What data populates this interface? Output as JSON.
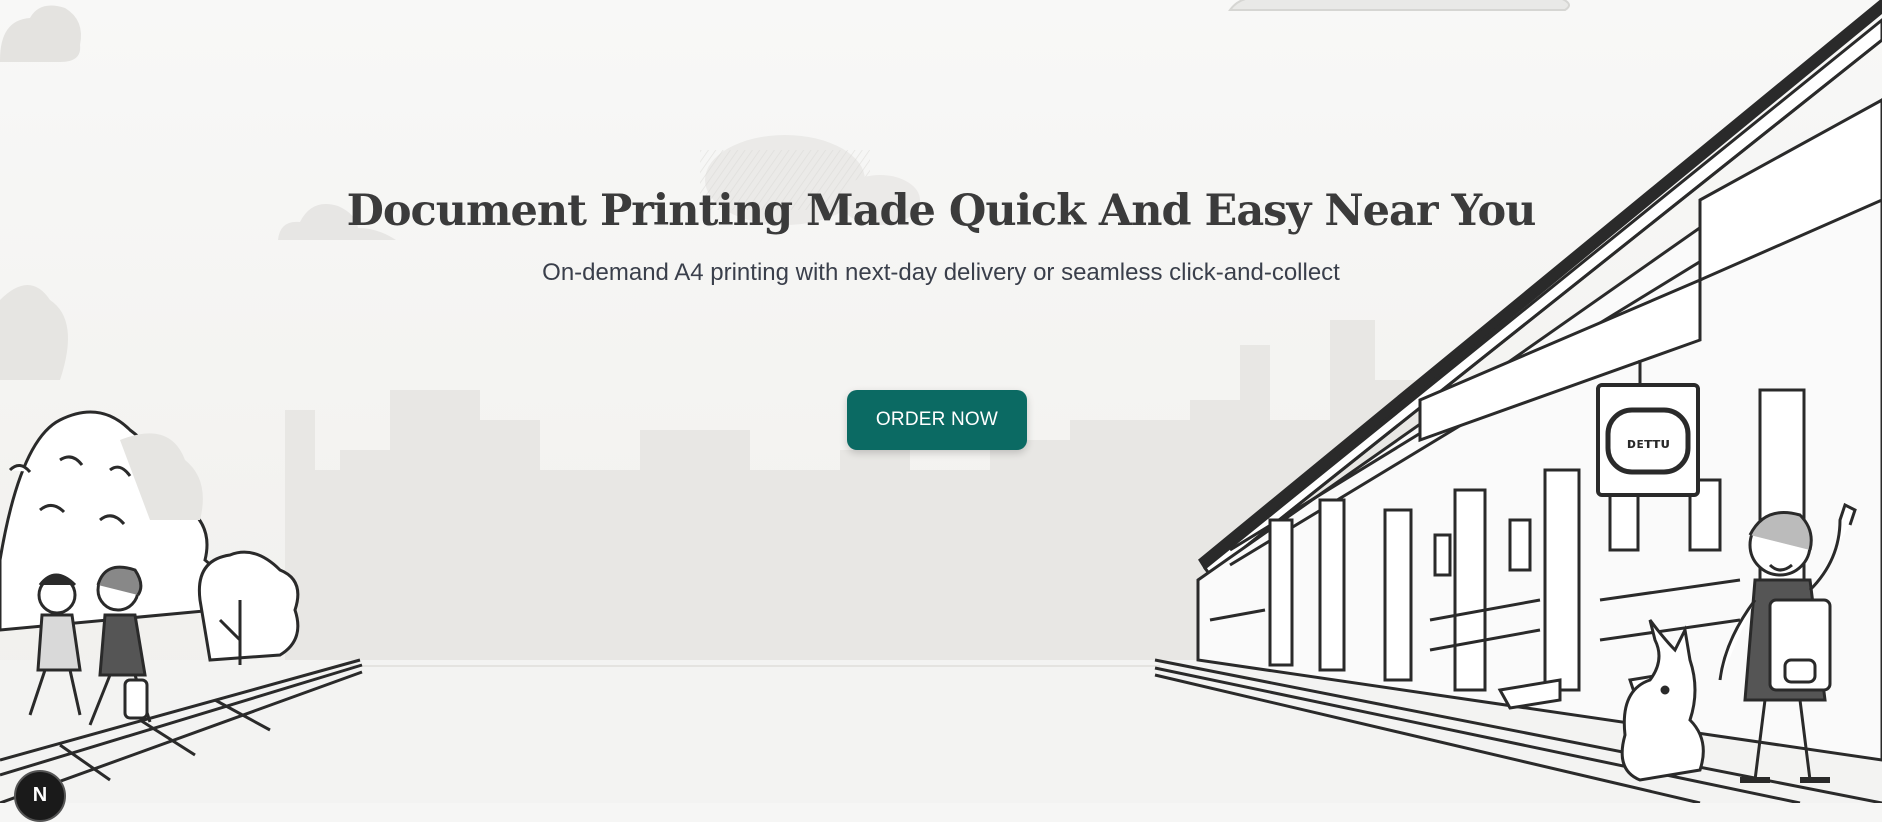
{
  "hero": {
    "title": "Document Printing Made Quick And Easy Near You",
    "subtitle": "On-demand A4 printing with next-day delivery or seamless click-and-collect",
    "cta_label": "ORDER NOW"
  },
  "shop_sign": {
    "text": "ᴅᴇᴛᴛᴜ"
  },
  "dev_badge": {
    "letter": "N"
  },
  "colors": {
    "background": "#f6f6f5",
    "title": "#3b3b3b",
    "subtitle": "#3a3f4b",
    "cta_background": "#0b6a63",
    "cta_text": "#ffffff",
    "line_art": "#2a2a2a",
    "skyline": "#e7e6e3"
  }
}
